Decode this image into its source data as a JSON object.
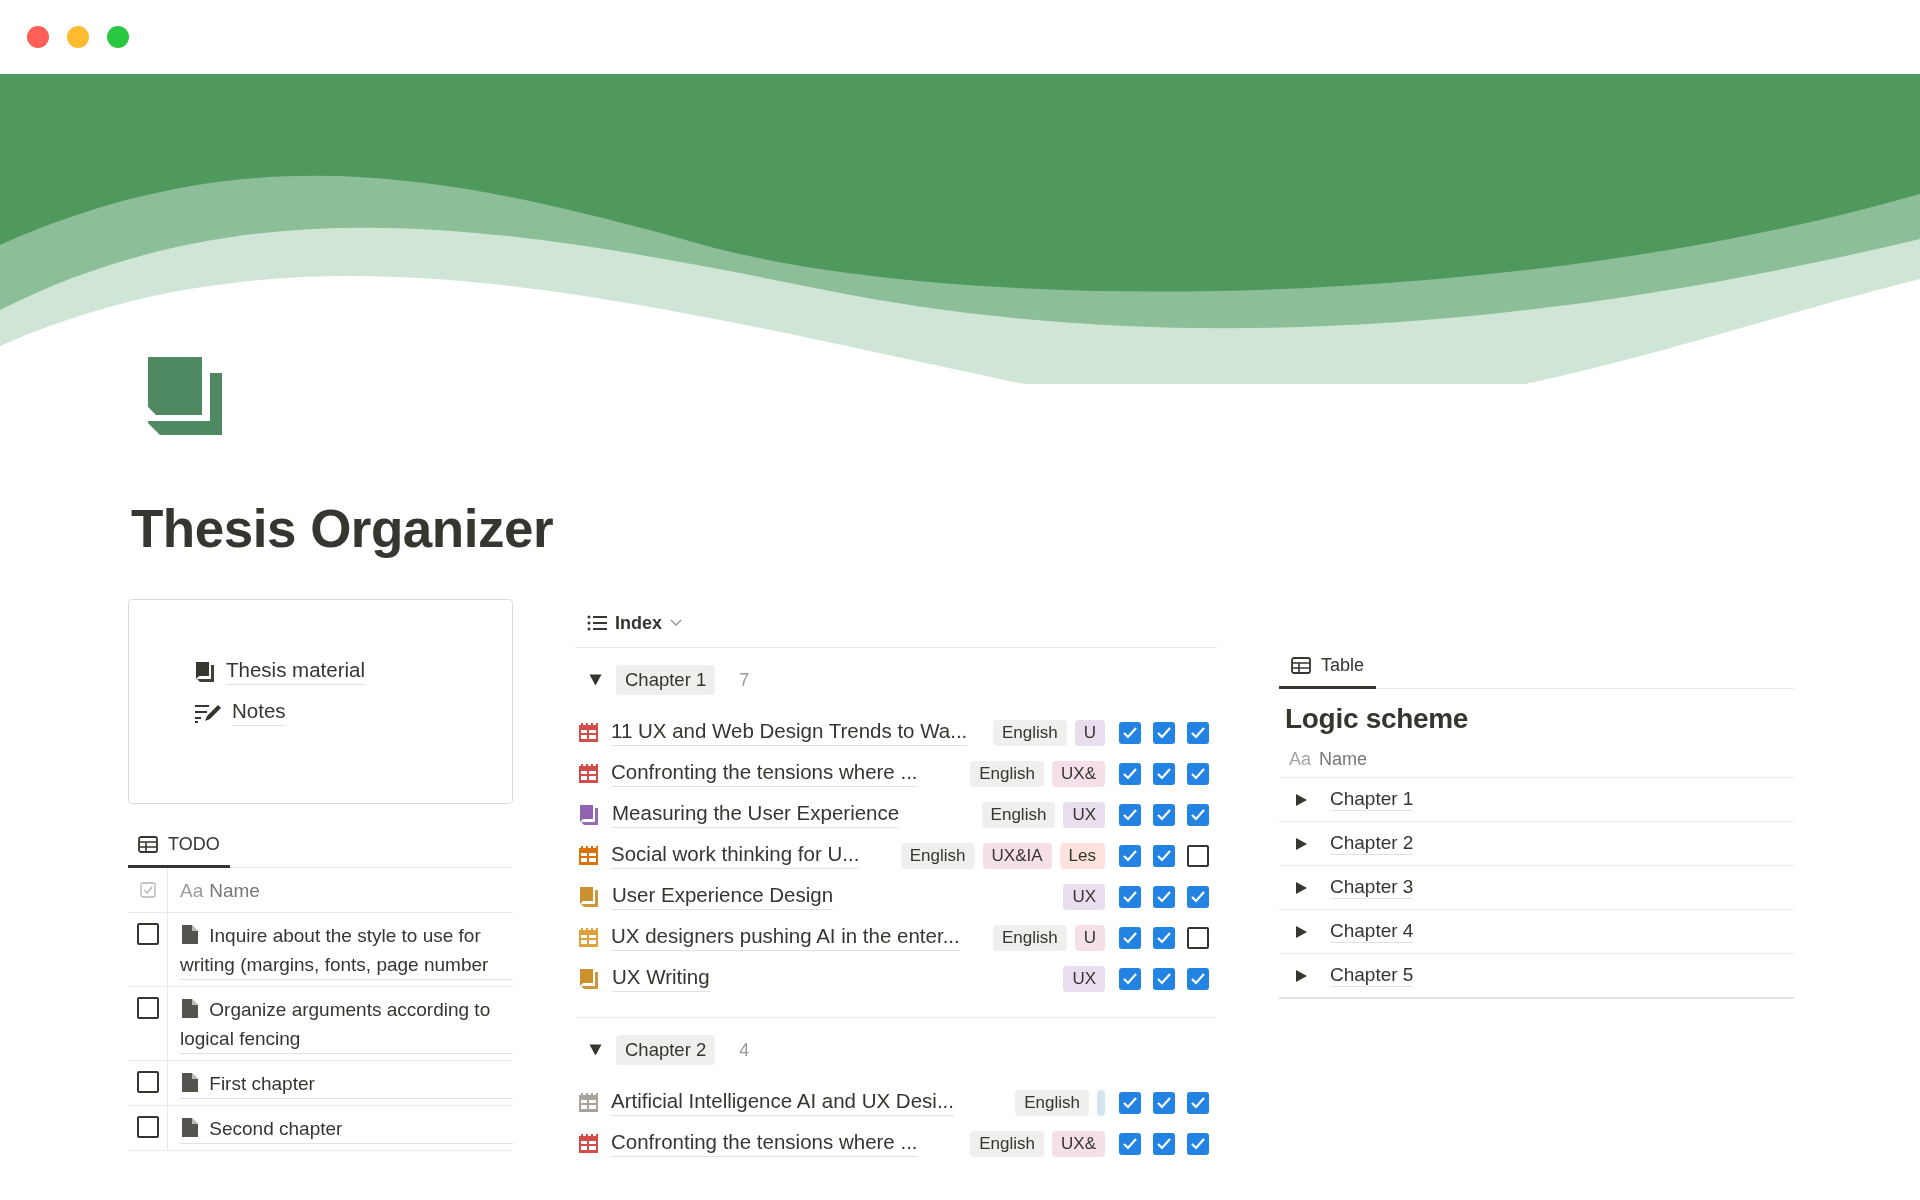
{
  "window_controls": [
    {
      "color": "#fe5f57"
    },
    {
      "color": "#febc2e"
    },
    {
      "color": "#28c840"
    }
  ],
  "page": {
    "title": "Thesis Organizer"
  },
  "links": [
    {
      "label": "Thesis material",
      "kind": "book"
    },
    {
      "label": "Notes",
      "kind": "notes"
    }
  ],
  "todo": {
    "tab": "TODO",
    "type_label": "Aa",
    "column": "Name",
    "rows": [
      {
        "name": "Inquire about the style to use for writing (margins, fonts, page number",
        "checked": false
      },
      {
        "name": "Organize arguments according to logical fencing",
        "checked": false
      },
      {
        "name": "First chapter",
        "checked": false
      },
      {
        "name": "Second chapter",
        "checked": false
      }
    ]
  },
  "index": {
    "view": "Index",
    "groups": [
      {
        "name": "Chapter 1",
        "count": "7",
        "expanded": true,
        "items": [
          {
            "title": "11 UX and Web Design Trends to Wa...",
            "kind": "calendar",
            "color": "#d44c47",
            "tags": [
              {
                "label": "English",
                "color": "#efefed"
              },
              {
                "label": "U",
                "color": "#e8deee"
              }
            ],
            "checks": [
              {
                "checked": true
              },
              {
                "checked": true
              },
              {
                "checked": true
              }
            ]
          },
          {
            "title": "Confronting the tensions where ...",
            "kind": "calendar",
            "color": "#d44c47",
            "tags": [
              {
                "label": "English",
                "color": "#efefed"
              },
              {
                "label": "UX&",
                "color": "#f5e0e9"
              }
            ],
            "checks": [
              {
                "checked": true
              },
              {
                "checked": true
              },
              {
                "checked": true
              }
            ]
          },
          {
            "title": "Measuring the User Experience",
            "kind": "book",
            "color": "#9065b0",
            "tags": [
              {
                "label": "English",
                "color": "#efefed"
              },
              {
                "label": "UX",
                "color": "#e8deee"
              }
            ],
            "checks": [
              {
                "checked": true
              },
              {
                "checked": true
              },
              {
                "checked": true
              }
            ]
          },
          {
            "title": "Social work thinking for U...",
            "kind": "calendar",
            "color": "#d9730d",
            "tags": [
              {
                "label": "English",
                "color": "#efefed"
              },
              {
                "label": "UX&IA",
                "color": "#f5e0e9"
              },
              {
                "label": "Les",
                "color": "#fde2dd"
              }
            ],
            "checks": [
              {
                "checked": true
              },
              {
                "checked": true
              },
              {
                "checked": false
              }
            ]
          },
          {
            "title": "User Experience Design",
            "kind": "book",
            "color": "#cb912f",
            "tags": [
              {
                "label": "UX",
                "color": "#e8deee"
              }
            ],
            "checks": [
              {
                "checked": true
              },
              {
                "checked": true
              },
              {
                "checked": true
              }
            ]
          },
          {
            "title": "UX designers pushing AI in the enter...",
            "kind": "calendar",
            "color": "#dfa23a",
            "tags": [
              {
                "label": "English",
                "color": "#efefed"
              },
              {
                "label": "U",
                "color": "#f5e0e9"
              }
            ],
            "checks": [
              {
                "checked": true
              },
              {
                "checked": true
              },
              {
                "checked": false
              }
            ]
          },
          {
            "title": "UX Writing",
            "kind": "book",
            "color": "#cb912f",
            "tags": [
              {
                "label": "UX",
                "color": "#e8deee"
              }
            ],
            "checks": [
              {
                "checked": true
              },
              {
                "checked": true
              },
              {
                "checked": true
              }
            ]
          }
        ]
      },
      {
        "name": "Chapter 2",
        "count": "4",
        "expanded": true,
        "items": [
          {
            "title": "Artificial Intelligence AI and UX Desi...",
            "kind": "calendar",
            "color": "#a8a49c",
            "tags": [
              {
                "label": "English",
                "color": "#efefed"
              },
              {
                "color": "#d3e5ef"
              }
            ],
            "checks": [
              {
                "checked": true
              },
              {
                "checked": true
              },
              {
                "checked": true
              }
            ]
          },
          {
            "title": "Confronting the tensions where ...",
            "kind": "calendar",
            "color": "#d44c47",
            "tags": [
              {
                "label": "English",
                "color": "#efefed"
              },
              {
                "label": "UX&",
                "color": "#f5e0e9"
              }
            ],
            "checks": [
              {
                "checked": true
              },
              {
                "checked": true
              },
              {
                "checked": true
              }
            ]
          }
        ]
      }
    ]
  },
  "logic": {
    "tab": "Table",
    "title": "Logic scheme",
    "type_label": "Aa",
    "column": "Name",
    "rows": [
      {
        "name": "Chapter 1",
        "expanded": false
      },
      {
        "name": "Chapter 2",
        "expanded": false
      },
      {
        "name": "Chapter 3",
        "expanded": false
      },
      {
        "name": "Chapter 4",
        "expanded": false
      },
      {
        "name": "Chapter 5",
        "expanded": false
      }
    ]
  }
}
